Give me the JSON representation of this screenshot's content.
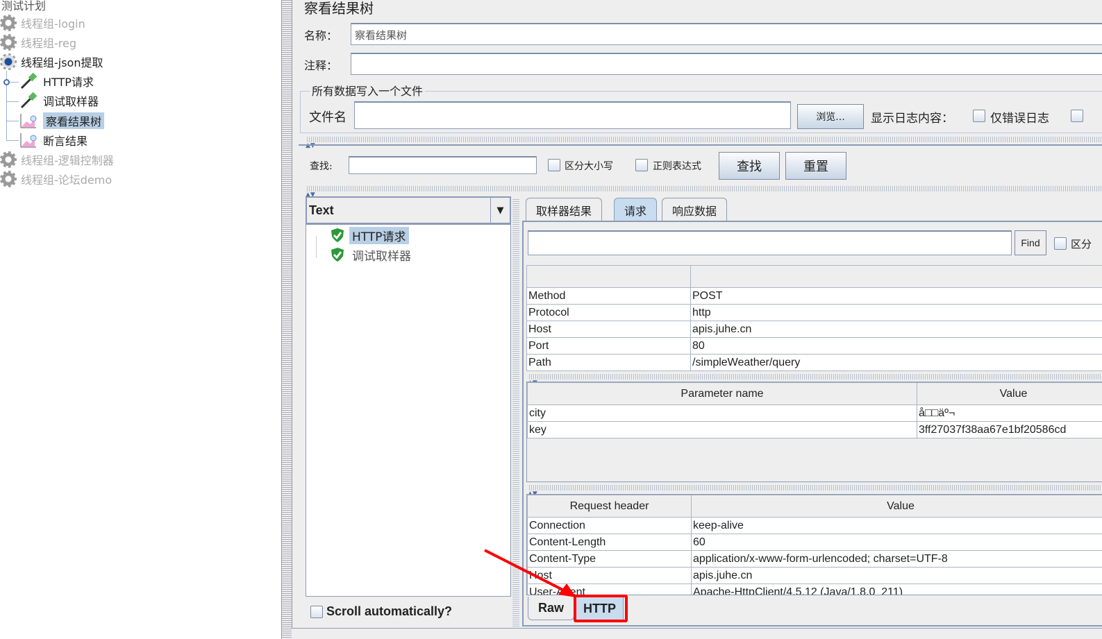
{
  "tree": {
    "root": "测试计划",
    "items": [
      {
        "label": "线程组-login",
        "disabled": true
      },
      {
        "label": "线程组-reg",
        "disabled": true
      },
      {
        "label": "线程组-json提取",
        "disabled": false
      },
      {
        "label": "HTTP请求"
      },
      {
        "label": "调试取样器"
      },
      {
        "label": "察看结果树",
        "selected": true
      },
      {
        "label": "断言结果"
      },
      {
        "label": "线程组-逻辑控制器",
        "disabled": true
      },
      {
        "label": "线程组-论坛demo",
        "disabled": true
      }
    ]
  },
  "panel": {
    "title": "察看结果树",
    "name_label": "名称：",
    "name_value": "察看结果树",
    "comment_label": "注释：",
    "comment_value": "",
    "file_group": "所有数据写入一个文件",
    "file_label": "文件名",
    "file_value": "",
    "browse": "浏览...",
    "log_label": "显示日志内容：",
    "errors_only": "仅错误日志"
  },
  "search": {
    "label": "查找:",
    "value": "",
    "case": "区分大小写",
    "regex": "正则表达式",
    "find": "查找",
    "reset": "重置"
  },
  "results": {
    "renderer": "Text",
    "items": [
      "HTTP请求",
      "调试取样器"
    ],
    "scroll_auto": "Scroll automatically?"
  },
  "tabs": [
    "取样器结果",
    "请求",
    "响应数据"
  ],
  "active_tab": "请求",
  "request": {
    "find_value": "",
    "find_btn": "Find",
    "case_short": "区分",
    "info": [
      [
        "Method",
        "POST"
      ],
      [
        "Protocol",
        "http"
      ],
      [
        "Host",
        "apis.juhe.cn"
      ],
      [
        "Port",
        "80"
      ],
      [
        "Path",
        "/simpleWeather/query"
      ]
    ],
    "param_headers": [
      "Parameter name",
      "Value"
    ],
    "params": [
      [
        "city",
        "å□□äº¬"
      ],
      [
        "key",
        "3ff27037f38aa67e1bf20586cd"
      ]
    ],
    "header_headers": [
      "Request header",
      "Value"
    ],
    "headers": [
      [
        "Connection",
        "keep-alive"
      ],
      [
        "Content-Length",
        "60"
      ],
      [
        "Content-Type",
        "application/x-www-form-urlencoded; charset=UTF-8"
      ],
      [
        "Host",
        "apis.juhe.cn"
      ],
      [
        "User-Agent",
        "Apache-HttpClient/4.5.12 (Java/1.8.0_211)"
      ]
    ],
    "subtabs": [
      "Raw",
      "HTTP"
    ],
    "active_subtab": "HTTP"
  },
  "colors": {
    "highlight": "#ff0000",
    "selection": "#b8cfe5"
  }
}
